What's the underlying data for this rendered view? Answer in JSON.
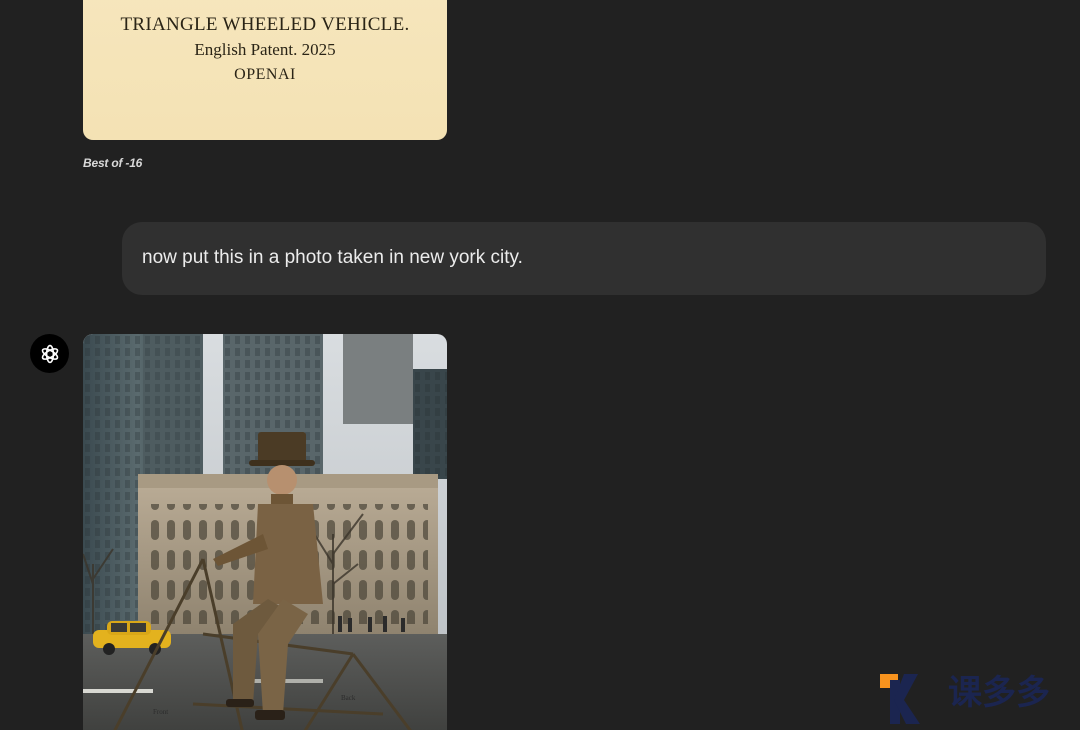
{
  "patent_image": {
    "title": "TRIANGLE WHEELED VEHICLE.",
    "subtitle": "English Patent. 2025",
    "org": "OPENAI"
  },
  "caption": "Best of -16",
  "user_message": "now put this in a photo taken in new york city.",
  "assistant": {
    "avatar_icon": "openai-logo-icon",
    "photo": {
      "front_label": "Front",
      "back_label": "Back"
    }
  },
  "watermark": {
    "text": "课多多"
  },
  "colors": {
    "background": "#212121",
    "bubble": "#303030",
    "text": "#ececec",
    "parchment": "#f5e4b8",
    "watermark_orange": "#f7931e",
    "watermark_navy": "#1b2550"
  }
}
